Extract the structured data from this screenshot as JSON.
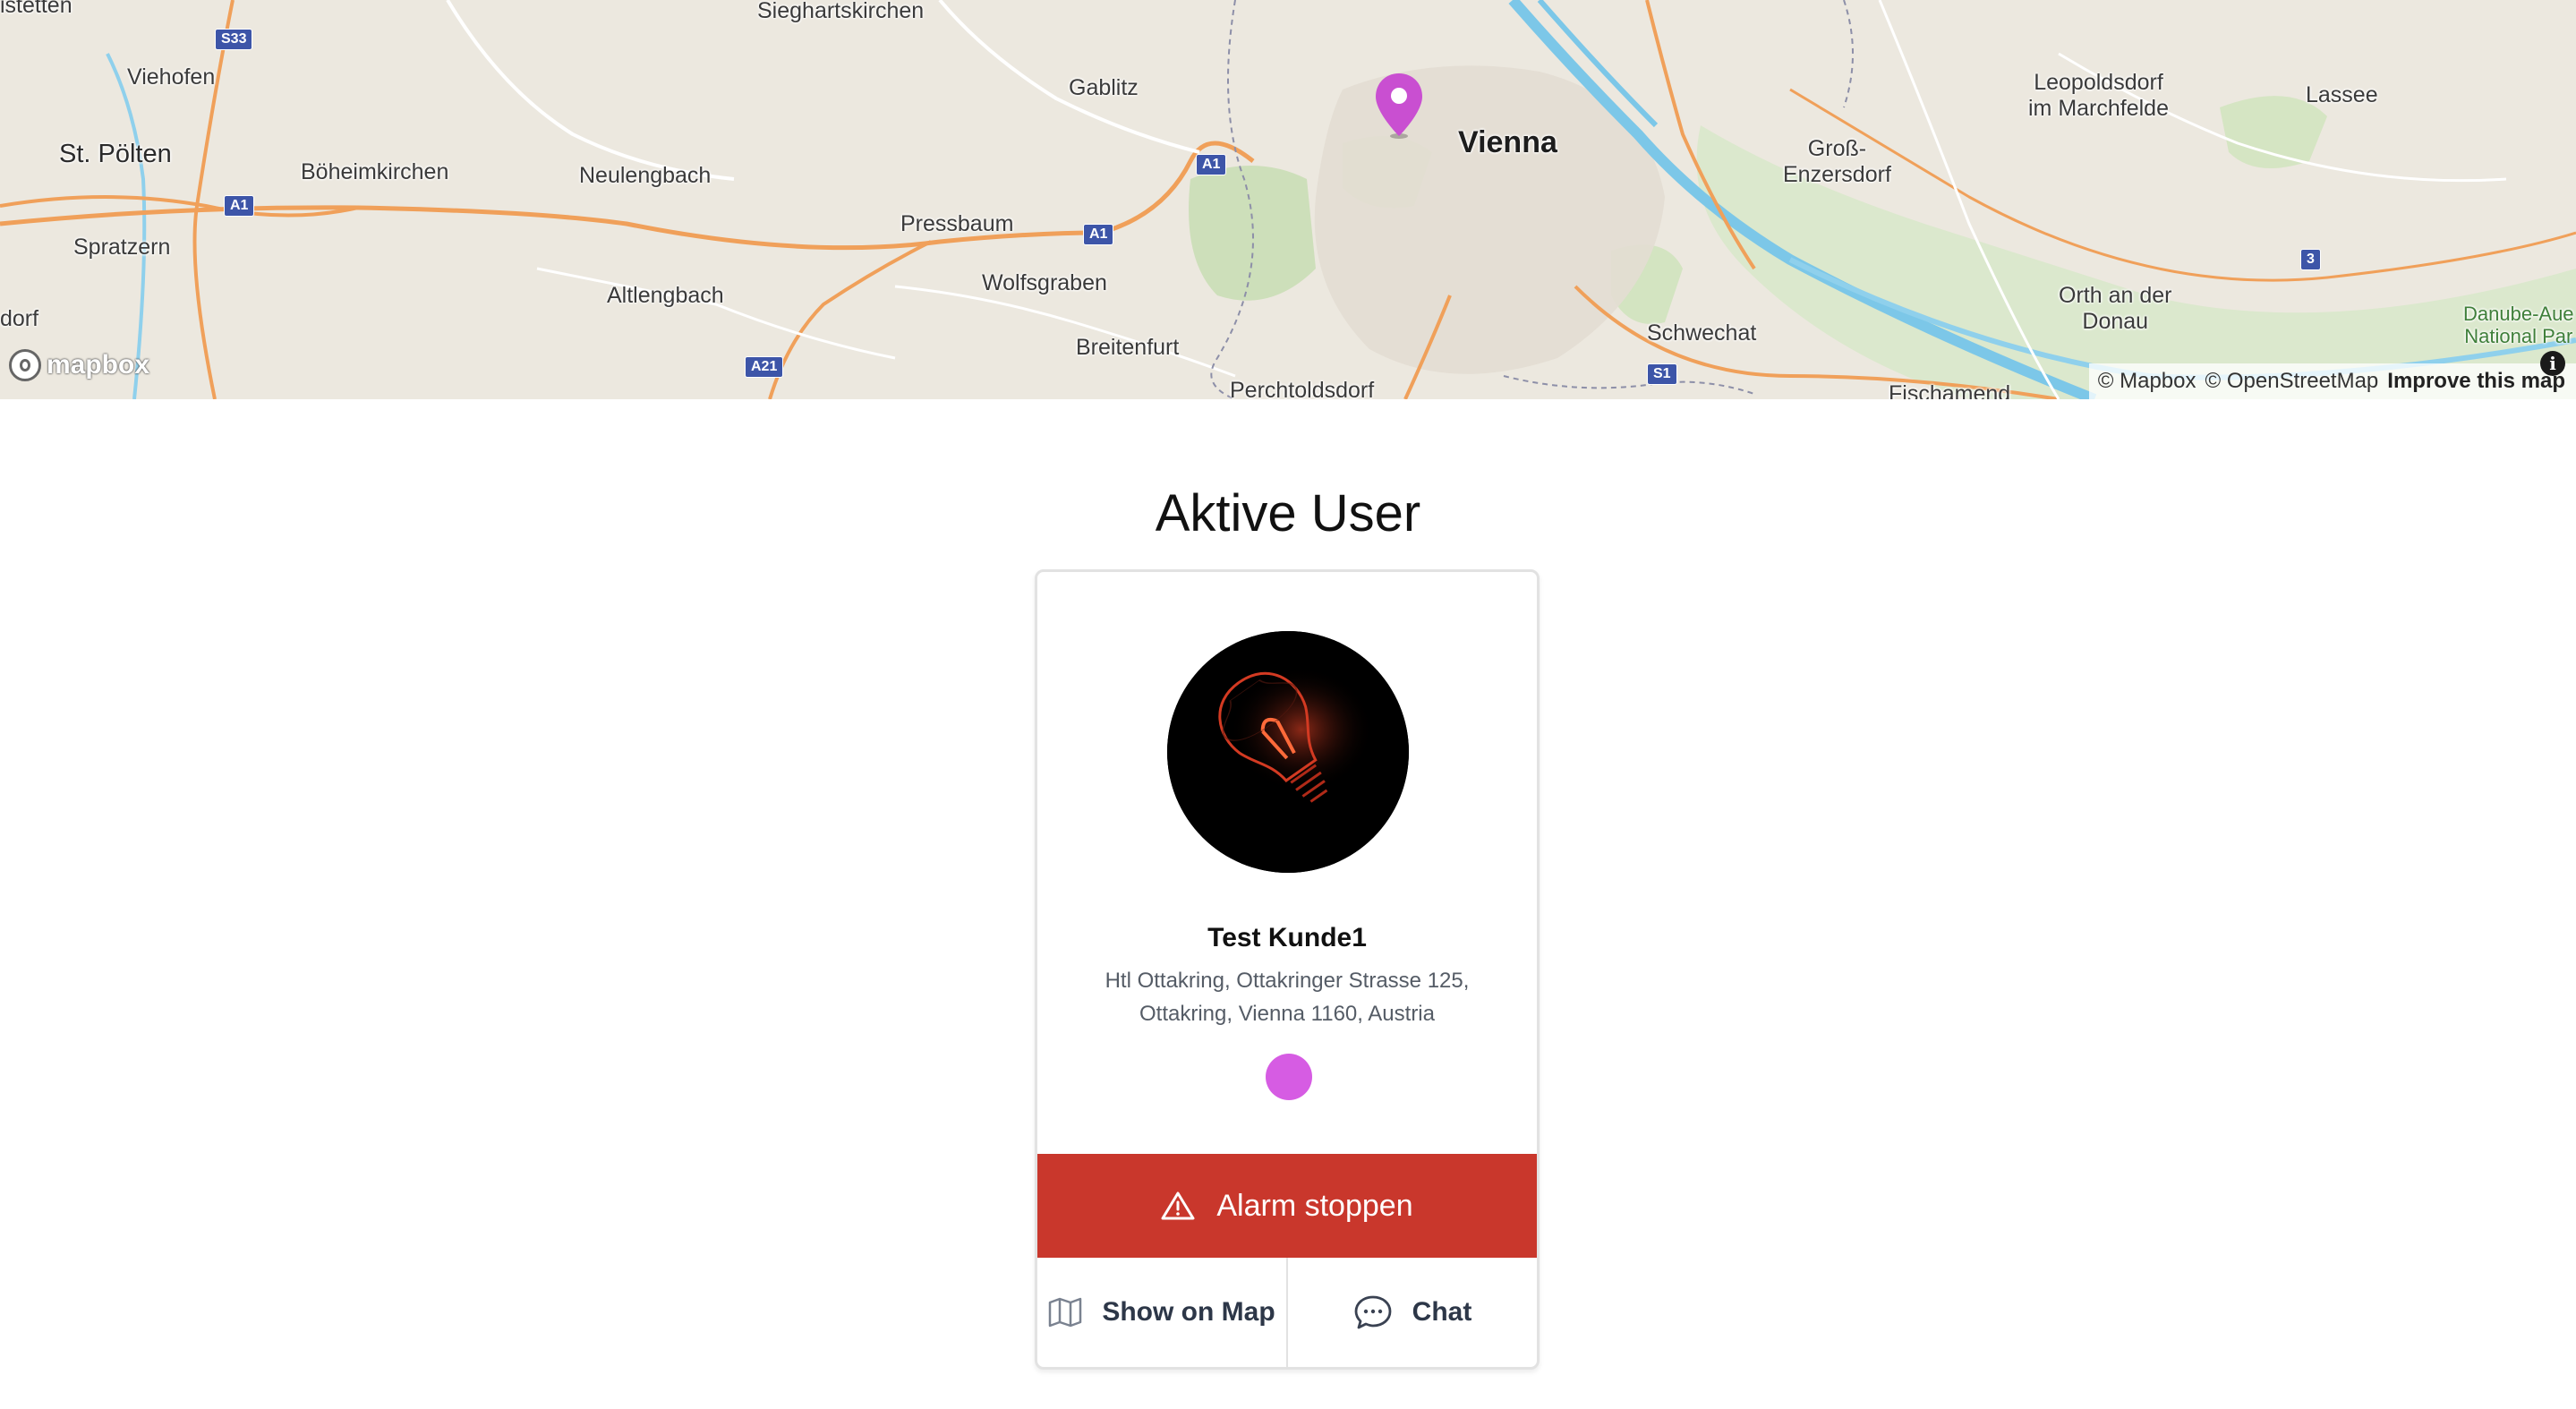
{
  "map": {
    "labels": {
      "statten": "istetten",
      "sieghartskirchen": "Sieghartskirchen",
      "viehofen": "Viehofen",
      "gablitz": "Gablitz",
      "st_poelten": "St. Pölten",
      "boeheimkirchen": "Böheimkirchen",
      "neulengbach": "Neulengbach",
      "vienna": "Vienna",
      "leopoldsdorf": "Leopoldsdorf\nim Marchfelde",
      "lassee": "Lassee",
      "gross_enzersdorf": "Groß-\nEnzersdorf",
      "pressbaum": "Pressbaum",
      "spratzern": "Spratzern",
      "wolfsgraben": "Wolfsgraben",
      "altlengbach": "Altlengbach",
      "orth": "Orth an der\nDonau",
      "schwechat": "Schwechat",
      "dorf": "dorf",
      "breitenfurt": "Breitenfurt",
      "danube_auen": "Danube-Aue\nNational Par",
      "perchtoldsdorf": "Perchtoldsdorf",
      "fischamend": "Fischamend"
    },
    "shields": {
      "s33": "S33",
      "a1_west": "A1",
      "a1_center": "A1",
      "a1_east": "A1",
      "a21": "A21",
      "s1": "S1",
      "r3": "3"
    },
    "logo_text": "mapbox",
    "attribution": {
      "mapbox": "© Mapbox",
      "osm": "© OpenStreetMap",
      "improve": "Improve this map",
      "info_icon": "i"
    },
    "pin_color": "#c94fd1"
  },
  "page_title": "Aktive User",
  "user_card": {
    "name": "Test Kunde1",
    "address": "Htl Ottakring, Ottakringer Strasse 125, Ottakring, Vienna 1160, Austria",
    "status_color": "#d65ce3",
    "avatar_icon": "light-bulb-image",
    "alarm_button": {
      "label": "Alarm stoppen",
      "icon": "warning-triangle-icon",
      "color": "#c9372c"
    },
    "actions": [
      {
        "label": "Show on Map",
        "icon": "map-icon"
      },
      {
        "label": "Chat",
        "icon": "chat-bubble-icon"
      }
    ]
  }
}
